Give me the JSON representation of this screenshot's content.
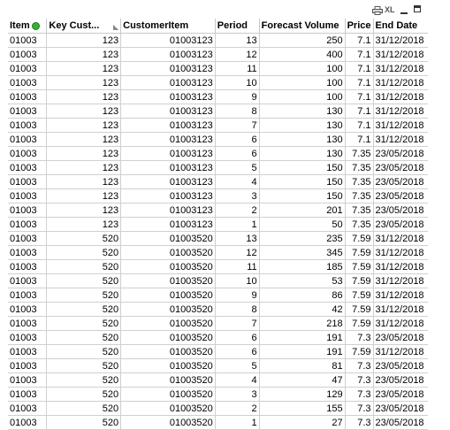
{
  "caption": {
    "icons": [
      "print-icon",
      "xl-icon",
      "minimize-icon",
      "maximize-icon"
    ],
    "xl_label": "XL"
  },
  "columns": [
    "Item",
    "Key Cust...",
    "CustomerItem",
    "Period",
    "Forecast Volume",
    "Price",
    "End Date"
  ],
  "rows": [
    [
      "01003",
      "123",
      "01003123",
      "13",
      "250",
      "7.1",
      "31/12/2018"
    ],
    [
      "01003",
      "123",
      "01003123",
      "12",
      "400",
      "7.1",
      "31/12/2018"
    ],
    [
      "01003",
      "123",
      "01003123",
      "11",
      "100",
      "7.1",
      "31/12/2018"
    ],
    [
      "01003",
      "123",
      "01003123",
      "10",
      "100",
      "7.1",
      "31/12/2018"
    ],
    [
      "01003",
      "123",
      "01003123",
      "9",
      "100",
      "7.1",
      "31/12/2018"
    ],
    [
      "01003",
      "123",
      "01003123",
      "8",
      "130",
      "7.1",
      "31/12/2018"
    ],
    [
      "01003",
      "123",
      "01003123",
      "7",
      "130",
      "7.1",
      "31/12/2018"
    ],
    [
      "01003",
      "123",
      "01003123",
      "6",
      "130",
      "7.1",
      "31/12/2018"
    ],
    [
      "01003",
      "123",
      "01003123",
      "6",
      "130",
      "7.35",
      "23/05/2018"
    ],
    [
      "01003",
      "123",
      "01003123",
      "5",
      "150",
      "7.35",
      "23/05/2018"
    ],
    [
      "01003",
      "123",
      "01003123",
      "4",
      "150",
      "7.35",
      "23/05/2018"
    ],
    [
      "01003",
      "123",
      "01003123",
      "3",
      "150",
      "7.35",
      "23/05/2018"
    ],
    [
      "01003",
      "123",
      "01003123",
      "2",
      "201",
      "7.35",
      "23/05/2018"
    ],
    [
      "01003",
      "123",
      "01003123",
      "1",
      "50",
      "7.35",
      "23/05/2018"
    ],
    [
      "01003",
      "520",
      "01003520",
      "13",
      "235",
      "7.59",
      "31/12/2018"
    ],
    [
      "01003",
      "520",
      "01003520",
      "12",
      "345",
      "7.59",
      "31/12/2018"
    ],
    [
      "01003",
      "520",
      "01003520",
      "11",
      "185",
      "7.59",
      "31/12/2018"
    ],
    [
      "01003",
      "520",
      "01003520",
      "10",
      "53",
      "7.59",
      "31/12/2018"
    ],
    [
      "01003",
      "520",
      "01003520",
      "9",
      "86",
      "7.59",
      "31/12/2018"
    ],
    [
      "01003",
      "520",
      "01003520",
      "8",
      "42",
      "7.59",
      "31/12/2018"
    ],
    [
      "01003",
      "520",
      "01003520",
      "7",
      "218",
      "7.59",
      "31/12/2018"
    ],
    [
      "01003",
      "520",
      "01003520",
      "6",
      "191",
      "7.3",
      "23/05/2018"
    ],
    [
      "01003",
      "520",
      "01003520",
      "6",
      "191",
      "7.59",
      "31/12/2018"
    ],
    [
      "01003",
      "520",
      "01003520",
      "5",
      "81",
      "7.3",
      "23/05/2018"
    ],
    [
      "01003",
      "520",
      "01003520",
      "4",
      "47",
      "7.3",
      "23/05/2018"
    ],
    [
      "01003",
      "520",
      "01003520",
      "3",
      "129",
      "7.3",
      "23/05/2018"
    ],
    [
      "01003",
      "520",
      "01003520",
      "2",
      "155",
      "7.3",
      "23/05/2018"
    ],
    [
      "01003",
      "520",
      "01003520",
      "1",
      "27",
      "7.3",
      "23/05/2018"
    ]
  ]
}
